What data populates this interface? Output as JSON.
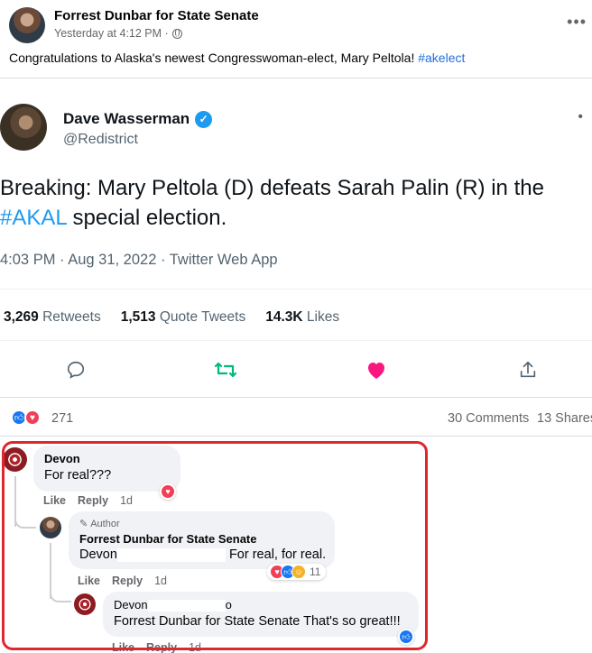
{
  "post": {
    "page_name": "Forrest Dunbar for State Senate",
    "timestamp": "Yesterday at 4:12 PM ·",
    "text_before": "Congratulations to Alaska's newest Congresswoman-elect, Mary Peltola! ",
    "hashtag": "#akelect"
  },
  "tweet": {
    "name": "Dave Wasserman",
    "handle": "@Redistrict",
    "text_part1": "Breaking: Mary Peltola (D) defeats Sarah Palin (R) in the ",
    "hashtag": "#AKAL",
    "text_part2": " special election.",
    "time": "4:03 PM · Aug 31, 2022 · Twitter Web App",
    "retweets_count": "3,269",
    "retweets_label": "Retweets",
    "quote_count": "1,513",
    "quote_label": "Quote Tweets",
    "likes_count": "14.3K",
    "likes_label": "Likes"
  },
  "reactions": {
    "count": "271",
    "comments": "30 Comments",
    "shares": "13 Shares"
  },
  "comments": {
    "c1": {
      "author": "Devon",
      "text": "For real???",
      "like": "Like",
      "reply": "Reply",
      "age": "1d"
    },
    "c2": {
      "author_tag": "Author",
      "author": "Forrest Dunbar for State Senate",
      "mention": "Devon",
      "text": "For real, for real.",
      "like": "Like",
      "reply": "Reply",
      "age": "1d",
      "reaction_count": "11"
    },
    "c3": {
      "author": "Devon",
      "author_suffix": "o",
      "mention": "Forrest Dunbar for State Senate",
      "text": "That's so great!!!",
      "like": "Like",
      "reply": "Reply",
      "age": "1d"
    }
  },
  "colors": {
    "accent_blue": "#1877f2",
    "love_red": "#f33e58",
    "retweet_green": "#00ba7c",
    "like_pink": "#f91880",
    "highlight_red": "#e0262f"
  }
}
